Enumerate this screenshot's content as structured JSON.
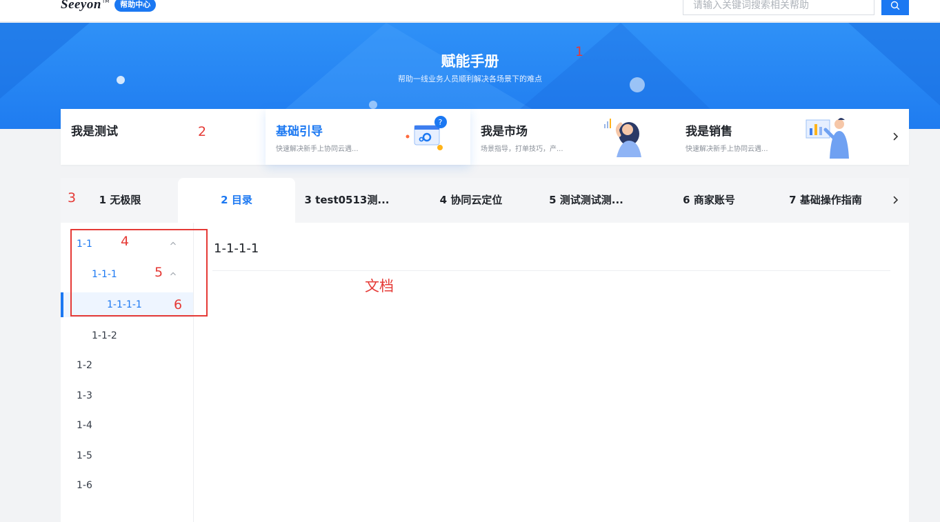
{
  "header": {
    "logo": "Seeyon",
    "logo_tm": "TM",
    "help_badge": "帮助中心",
    "search_placeholder": "请输入关键词搜索相关帮助",
    "search_icon": "search-icon"
  },
  "banner": {
    "title": "赋能手册",
    "subtitle": "帮助一线业务人员顺利解决各场景下的难点"
  },
  "annotations": {
    "a1": "1",
    "a2": "2",
    "a3": "3",
    "a4": "4",
    "a5": "5",
    "a6": "6",
    "doc": "文档"
  },
  "cards": [
    {
      "title": "我是测试",
      "desc": ""
    },
    {
      "title": "基础引导",
      "desc": "快速解决新手上协同云遇..."
    },
    {
      "title": "我是市场",
      "desc": "场景指导，打单技巧，产..."
    },
    {
      "title": "我是销售",
      "desc": "快速解决新手上协同云遇..."
    }
  ],
  "tabs": [
    {
      "label": "1 无极限"
    },
    {
      "label": "2 目录"
    },
    {
      "label": "3 test0513测..."
    },
    {
      "label": "4 协同云定位"
    },
    {
      "label": "5 测试测试测..."
    },
    {
      "label": "6 商家账号"
    },
    {
      "label": "7 基础操作指南"
    }
  ],
  "tree": [
    {
      "label": "1-1"
    },
    {
      "label": "1-1-1"
    },
    {
      "label": "1-1-1-1"
    },
    {
      "label": "1-1-2"
    },
    {
      "label": "1-2"
    },
    {
      "label": "1-3"
    },
    {
      "label": "1-4"
    },
    {
      "label": "1-5"
    },
    {
      "label": "1-6"
    }
  ],
  "document": {
    "title": "1-1-1-1"
  },
  "colors": {
    "accent": "#1b78f2",
    "annotation": "#e53935",
    "banner": "#2f91f7"
  }
}
